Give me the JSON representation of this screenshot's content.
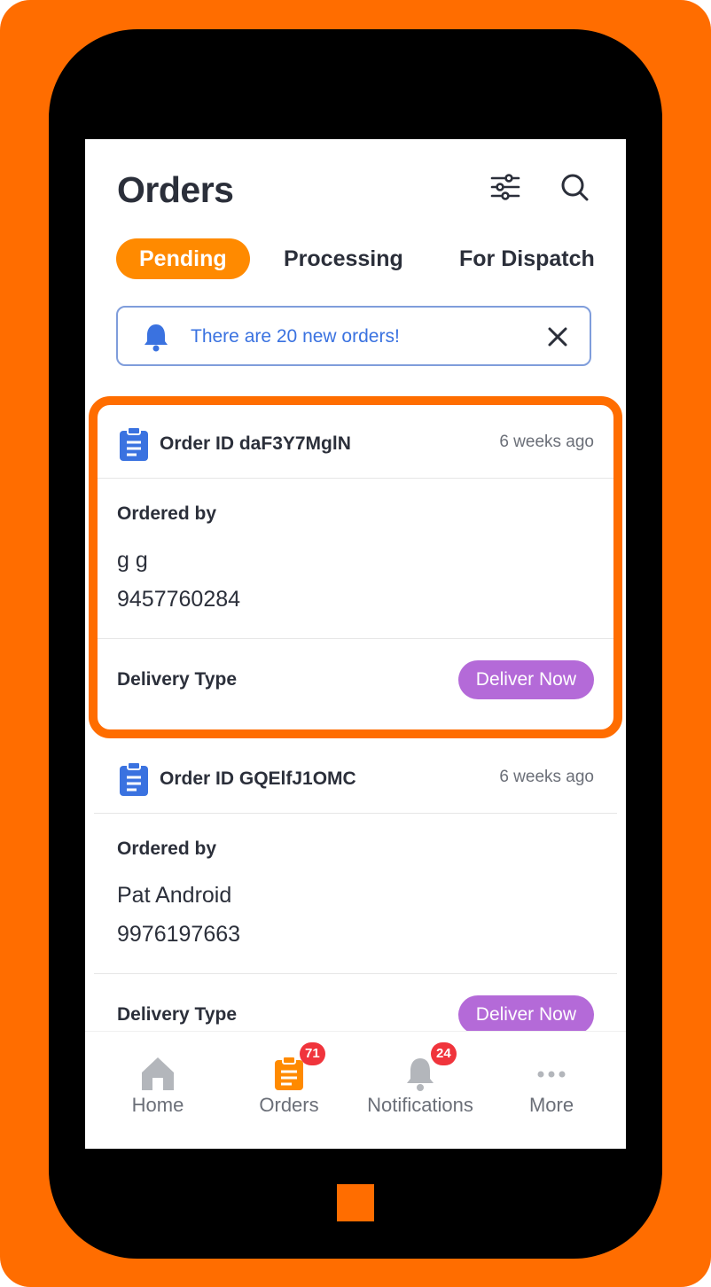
{
  "header": {
    "title": "Orders"
  },
  "tabs": [
    {
      "label": "Pending",
      "active": true
    },
    {
      "label": "Processing",
      "active": false
    },
    {
      "label": "For Dispatch",
      "active": false
    }
  ],
  "banner": {
    "message": "There are 20 new orders!"
  },
  "orders": [
    {
      "order_id": "Order ID daF3Y7MglN",
      "time": "6 weeks ago",
      "ordered_by_label": "Ordered by",
      "customer_name": "g g",
      "customer_phone": "9457760284",
      "delivery_type_label": "Delivery Type",
      "delivery_action": "Deliver Now"
    },
    {
      "order_id": "Order ID GQElfJ1OMC",
      "time": "6 weeks ago",
      "ordered_by_label": "Ordered by",
      "customer_name": "Pat Android",
      "customer_phone": "9976197663",
      "delivery_type_label": "Delivery Type",
      "delivery_action": "Deliver Now"
    }
  ],
  "bottom_nav": [
    {
      "label": "Home",
      "icon": "home-icon",
      "active": false
    },
    {
      "label": "Orders",
      "icon": "clipboard-icon",
      "active": true,
      "badge": "71"
    },
    {
      "label": "Notifications",
      "icon": "bell-icon",
      "active": false,
      "badge": "24"
    },
    {
      "label": "More",
      "icon": "more-dots-icon",
      "active": false
    }
  ],
  "colors": {
    "accent": "#ff8a00",
    "frame": "#ff6d00",
    "banner_text": "#3a72e0",
    "deliver_button": "#b46ad8",
    "badge": "#f0343c"
  }
}
